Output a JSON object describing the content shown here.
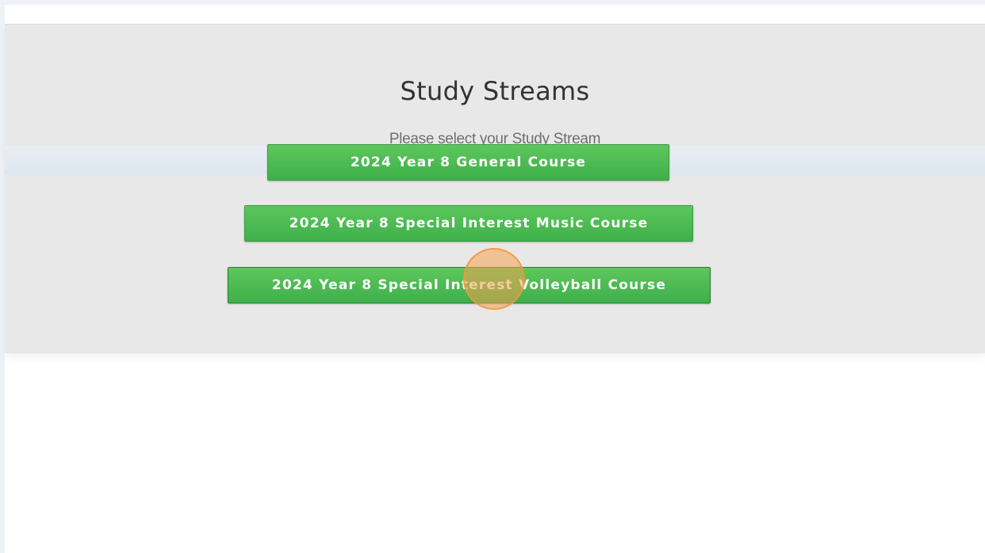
{
  "page": {
    "title": "Study Streams",
    "subtitle": "Please select your Study Stream"
  },
  "streams": [
    {
      "label": "2024 Year 8 General Course"
    },
    {
      "label": "2024 Year 8 Special Interest Music Course"
    },
    {
      "label": "2024 Year 8 Special Interest Volleyball Course"
    }
  ],
  "colors": {
    "button_green": "#4cbb4f",
    "panel_bg": "#e8e8e8",
    "click_marker": "#f5a050"
  }
}
